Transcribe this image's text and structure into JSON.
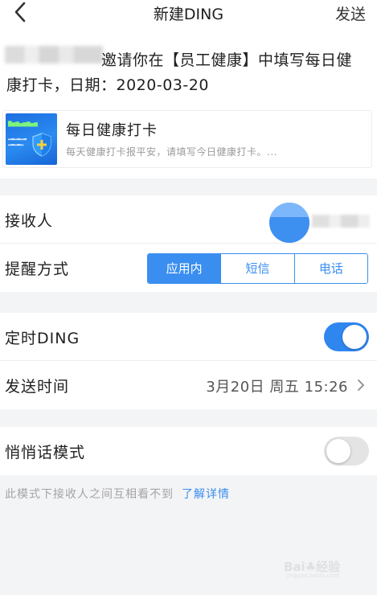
{
  "nav": {
    "title": "新建DING",
    "send_label": "发送"
  },
  "message": {
    "text": "邀请你在【员工健康】中填写每日健康打卡，日期：2020-03-20"
  },
  "card": {
    "title": "每日健康打卡",
    "description": "每天健康打卡报平安，请填写今日健康打卡。..."
  },
  "recipients": {
    "label": "接收人"
  },
  "reminder": {
    "label": "提醒方式",
    "options": [
      "应用内",
      "短信",
      "电话"
    ],
    "selected": "应用内"
  },
  "scheduled": {
    "label": "定时DING",
    "enabled": true
  },
  "send_time": {
    "label": "发送时间",
    "value": "3月20日  周五  15:26"
  },
  "whisper": {
    "label": "悄悄话模式",
    "enabled": false
  },
  "hint": {
    "text": "此模式下接收人之间互相看不到",
    "link": "了解详情"
  },
  "colors": {
    "accent": "#3a8ef0",
    "toggle_on": "#2f86ef",
    "toggle_off": "#e4e4e4"
  },
  "icons": {
    "back": "chevron-left-icon",
    "row_arrow": "chevron-right-icon"
  }
}
